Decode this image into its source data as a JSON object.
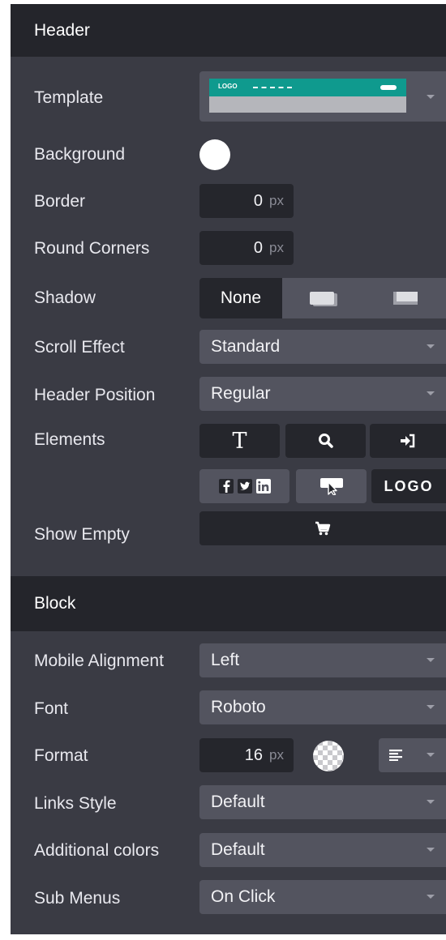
{
  "header_section": {
    "title": "Header"
  },
  "template": {
    "label": "Template",
    "preview_logo": "LOGO"
  },
  "background": {
    "label": "Background",
    "color": "#ffffff"
  },
  "border": {
    "label": "Border",
    "value": "0",
    "unit": "px"
  },
  "round_corners": {
    "label": "Round Corners",
    "value": "0",
    "unit": "px"
  },
  "shadow": {
    "label": "Shadow",
    "options": [
      "None",
      "shadow-soft-icon",
      "shadow-hard-icon"
    ],
    "selected": "None"
  },
  "scroll_effect": {
    "label": "Scroll Effect",
    "value": "Standard"
  },
  "header_position": {
    "label": "Header Position",
    "value": "Regular"
  },
  "elements": {
    "label": "Elements",
    "items": [
      "text-icon",
      "search-icon",
      "sign-in-icon",
      "social-icons",
      "call-to-action-icon",
      "logo-text"
    ],
    "logo_text": "LOGO",
    "text_glyph": "T"
  },
  "show_empty": {
    "label": "Show Empty",
    "icon": "cart-icon"
  },
  "block_section": {
    "title": "Block"
  },
  "mobile_alignment": {
    "label": "Mobile Alignment",
    "value": "Left"
  },
  "font": {
    "label": "Font",
    "value": "Roboto"
  },
  "format": {
    "label": "Format",
    "size": "16",
    "unit": "px"
  },
  "links_style": {
    "label": "Links Style",
    "value": "Default"
  },
  "additional_colors": {
    "label": "Additional colors",
    "value": "Default"
  },
  "sub_menus": {
    "label": "Sub Menus",
    "value": "On Click"
  },
  "colors": {
    "panel": "#3a3b44",
    "section_header": "#24252b",
    "dropdown": "#53545f",
    "input": "#25262c",
    "template_teal": "#0f9a8e"
  }
}
